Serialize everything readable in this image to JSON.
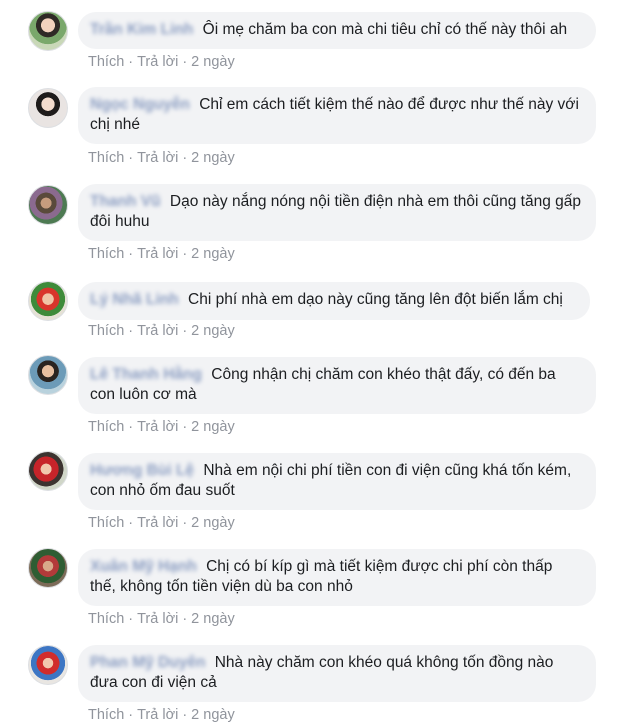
{
  "comments": [
    {
      "author": "Trần Kim Linh",
      "text": "Ôi mẹ chăm ba con mà chi tiêu chỉ có thế này thôi ah",
      "like": "Thích",
      "reply": "Trả lời",
      "time": "2 ngày"
    },
    {
      "author": "Ngọc Nguyễn",
      "text": "Chỉ em cách tiết kiệm thế nào để được như thế này với chị nhé",
      "like": "Thích",
      "reply": "Trả lời",
      "time": "2 ngày"
    },
    {
      "author": "Thanh Vũ",
      "text": "Dạo này nắng nóng nội tiền điện nhà em thôi cũng tăng gấp đôi huhu",
      "like": "Thích",
      "reply": "Trả lời",
      "time": "2 ngày"
    },
    {
      "author": "Lý Nhã Linh",
      "text": "Chi phí nhà em dạo này cũng tăng lên đột biến lắm chị",
      "like": "Thích",
      "reply": "Trả lời",
      "time": "2 ngày"
    },
    {
      "author": "Lê Thanh Hằng",
      "text": "Công nhận chị chăm con khéo thật đấy, có đến ba con luôn cơ mà",
      "like": "Thích",
      "reply": "Trả lời",
      "time": "2 ngày"
    },
    {
      "author": "Hương Bùi Lệ",
      "text": "Nhà em nội chi phí tiền con đi viện cũng khá tốn kém, con nhỏ ốm đau suốt",
      "like": "Thích",
      "reply": "Trả lời",
      "time": "2 ngày"
    },
    {
      "author": "Xuân Mỹ Hạnh",
      "text": "Chị có bí kíp gì mà tiết kiệm được chi phí còn thấp thế, không tốn tiền viện dù ba con nhỏ",
      "like": "Thích",
      "reply": "Trả lời",
      "time": "2 ngày"
    },
    {
      "author": "Phan Mỹ Duyên",
      "text": "Nhà này chăm con khéo quá không tốn đồng nào đưa con đi viện cả",
      "like": "Thích",
      "reply": "Trả lời",
      "time": "2 ngày"
    }
  ],
  "colors": {
    "bubble": "#f2f3f5",
    "author": "#385898",
    "meta": "#90949c"
  }
}
